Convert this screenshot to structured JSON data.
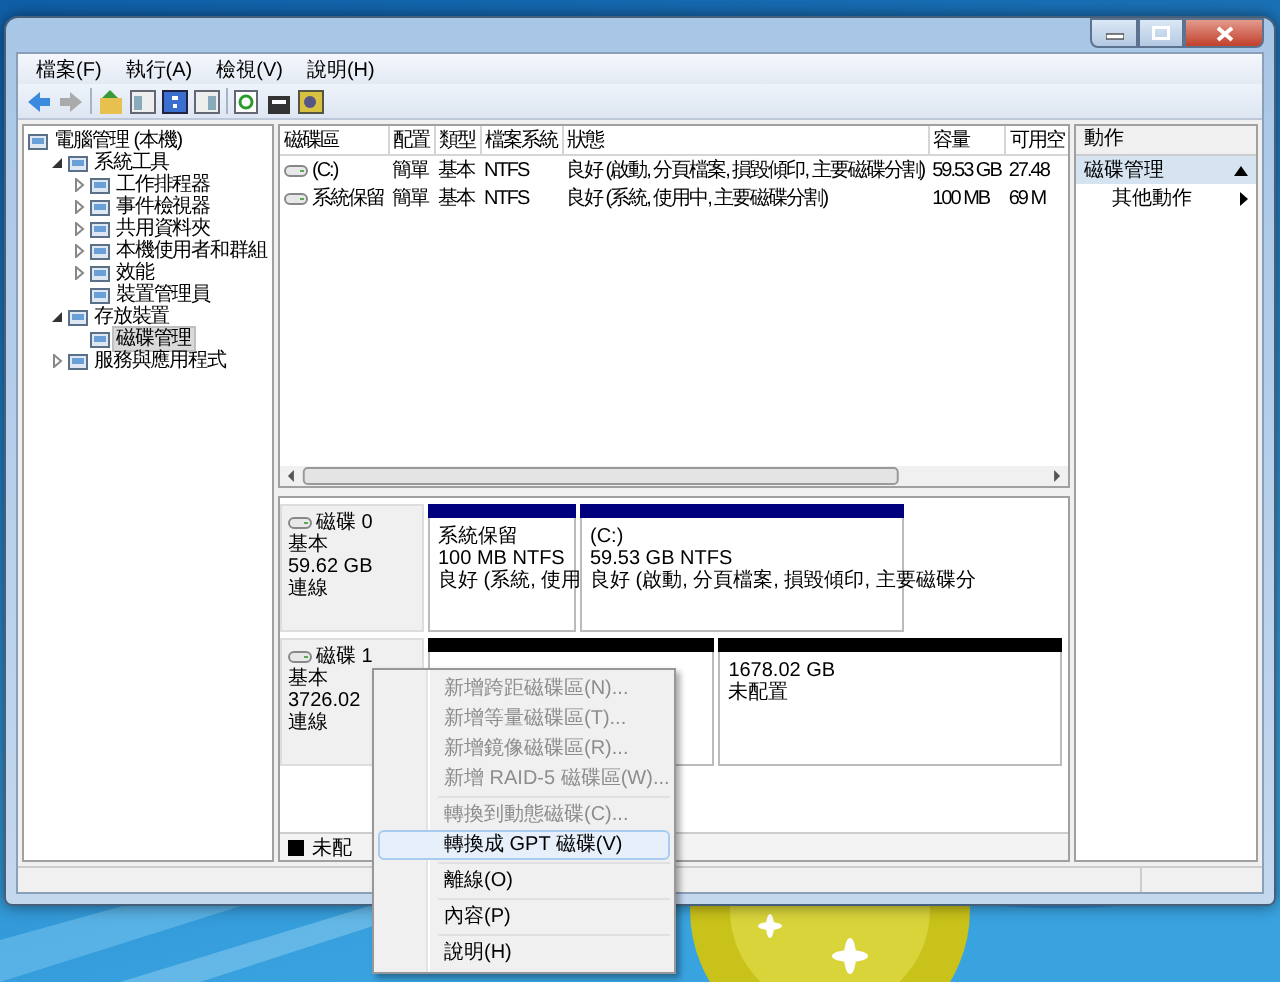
{
  "menu_bar": [
    "檔案(F)",
    "執行(A)",
    "檢視(V)",
    "說明(H)"
  ],
  "tree": [
    {
      "label": "電腦管理 (本機)",
      "selected": false,
      "children": [
        {
          "label": "系統工具",
          "expanded": true,
          "selected": false,
          "children": [
            {
              "label": "工作排程器",
              "expanded": false,
              "selected": false
            },
            {
              "label": "事件檢視器",
              "expanded": false,
              "selected": false
            },
            {
              "label": "共用資料夾",
              "expanded": false,
              "selected": false
            },
            {
              "label": "本機使用者和群組",
              "expanded": false,
              "selected": false
            },
            {
              "label": "效能",
              "expanded": false,
              "selected": false
            },
            {
              "label": "裝置管理員",
              "selected": false
            }
          ]
        },
        {
          "label": "存放裝置",
          "expanded": true,
          "selected": false,
          "children": [
            {
              "label": "磁碟管理",
              "selected": true
            }
          ]
        },
        {
          "label": "服務與應用程式",
          "expanded": false,
          "selected": false
        }
      ]
    }
  ],
  "volume_table": {
    "columns": [
      "磁碟區",
      "配置",
      "類型",
      "檔案系統",
      "狀態",
      "容量",
      "可用空"
    ],
    "rows": [
      {
        "cells": [
          "(C:)",
          "簡單",
          "基本",
          "NTFS",
          "良好 (啟動, 分頁檔案, 損毀傾印, 主要磁碟分割)",
          "59.53 GB",
          "27.48"
        ]
      },
      {
        "cells": [
          "系統保留",
          "簡單",
          "基本",
          "NTFS",
          "良好 (系統, 使用中, 主要磁碟分割)",
          "100 MB",
          "69 M"
        ]
      }
    ]
  },
  "disks": [
    {
      "name": "磁碟 0",
      "type": "基本",
      "size": "59.62 GB",
      "status": "連線",
      "partitions": [
        {
          "kind": "primary",
          "lines": [
            "系統保留",
            "100 MB NTFS",
            "良好 (系統, 使用"
          ]
        },
        {
          "kind": "primary",
          "lines": [
            "(C:)",
            "59.53 GB NTFS",
            "良好 (啟動, 分頁檔案, 損毀傾印, 主要磁碟分"
          ]
        }
      ]
    },
    {
      "name": "磁碟 1",
      "type": "基本",
      "size": "3726.02",
      "status": "連線",
      "partitions": [
        {
          "kind": "unallocated"
        },
        {
          "kind": "unallocated",
          "lines": [
            "1678.02 GB",
            "未配置"
          ]
        }
      ]
    }
  ],
  "legend": [
    {
      "kind": "unallocated",
      "label": "未配"
    }
  ],
  "actions": {
    "title": "動作",
    "sections": [
      {
        "title": "磁碟管理",
        "expanded": true,
        "items": [
          "其他動作"
        ]
      }
    ]
  },
  "context_menu": [
    {
      "kind": "item",
      "label": "新增跨距磁碟區(N)...",
      "disabled": true,
      "selected": false
    },
    {
      "kind": "item",
      "label": "新增等量磁碟區(T)...",
      "disabled": true,
      "selected": false
    },
    {
      "kind": "item",
      "label": "新增鏡像磁碟區(R)...",
      "disabled": true,
      "selected": false
    },
    {
      "kind": "item",
      "label": "新增 RAID-5 磁碟區(W)...",
      "disabled": true,
      "selected": false
    },
    {
      "kind": "separator"
    },
    {
      "kind": "item",
      "label": "轉換到動態磁碟(C)...",
      "disabled": true,
      "selected": false
    },
    {
      "kind": "item",
      "label": "轉換成 GPT 磁碟(V)",
      "disabled": false,
      "selected": true
    },
    {
      "kind": "separator"
    },
    {
      "kind": "item",
      "label": "離線(O)",
      "disabled": false,
      "selected": false
    },
    {
      "kind": "separator"
    },
    {
      "kind": "item",
      "label": "內容(P)",
      "disabled": false,
      "selected": false
    },
    {
      "kind": "separator"
    },
    {
      "kind": "item",
      "label": "說明(H)",
      "disabled": false,
      "selected": false
    }
  ]
}
